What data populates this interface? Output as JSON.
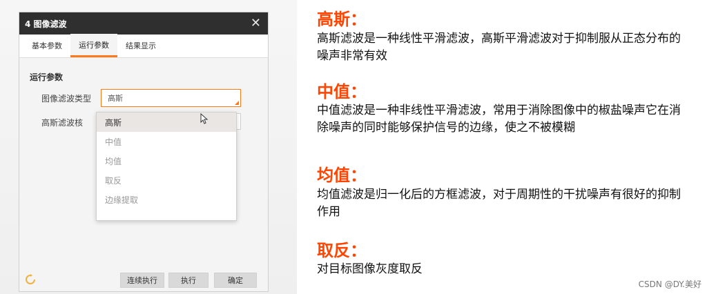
{
  "dialog": {
    "title": "4 图像滤波",
    "close_glyph": "✕",
    "tabs": [
      "基本参数",
      "运行参数",
      "结果显示"
    ],
    "active_tab": "运行参数",
    "section_title": "运行参数",
    "filter_type_label": "图像滤波类型",
    "filter_type_value": "高斯",
    "kernel_label": "高斯滤波核",
    "dropdown_options": [
      "高斯",
      "中值",
      "均值",
      "取反",
      "边缘提取"
    ],
    "buttons": {
      "continuous": "连续执行",
      "run": "执行",
      "confirm": "确定"
    }
  },
  "notes": [
    {
      "heading": "高斯：",
      "text": "高斯滤波是一种线性平滑滤波，高斯平滑滤波对于抑制服从正态分布的噪声非常有效"
    },
    {
      "heading": "中值：",
      "text": "中值滤波是一种非线性平滑滤波，常用于消除图像中的椒盐噪声它在消除噪声的同时能够保护信号的边缘，使之不被模糊"
    },
    {
      "heading": "均值：",
      "text": "均值滤波是归一化后的方框滤波，对于周期性的干扰噪声有很好的抑制作用"
    },
    {
      "heading": "取反：",
      "text": "对目标图像灰度取反"
    }
  ],
  "watermark": "CSDN @DY.美好",
  "colors": {
    "accent": "#ff7a1a",
    "heading": "#ff4500",
    "titlebar": "#2f2f2f"
  }
}
